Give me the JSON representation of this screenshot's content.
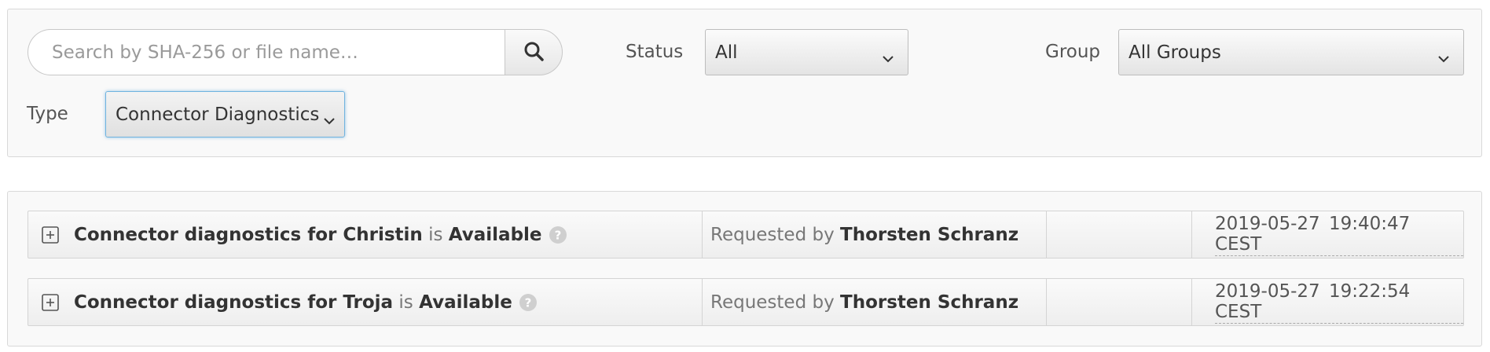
{
  "filters": {
    "search": {
      "placeholder": "Search by SHA-256 or file name…",
      "value": ""
    },
    "status": {
      "label": "Status",
      "selected": "All"
    },
    "group": {
      "label": "Group",
      "selected": "All Groups"
    },
    "type": {
      "label": "Type",
      "selected": "Connector Diagnostics"
    }
  },
  "results": [
    {
      "title": "Connector diagnostics for Christin",
      "is_word": "is",
      "state": "Available",
      "requested_prefix": "Requested by",
      "requester": "Thorsten Schranz",
      "timestamp": "2019-05-27 19:40:47 CEST"
    },
    {
      "title": "Connector diagnostics for Troja",
      "is_word": "is",
      "state": "Available",
      "requested_prefix": "Requested by",
      "requester": "Thorsten Schranz",
      "timestamp": "2019-05-27 19:22:54 CEST"
    }
  ],
  "icons": {
    "search": "search-icon",
    "chevron": "chevron-down-icon",
    "expand": "plus-square-icon",
    "help": "question-circle-icon"
  },
  "colors": {
    "focus_border": "#6fb3df",
    "panel_bg": "#f9f9f9"
  }
}
